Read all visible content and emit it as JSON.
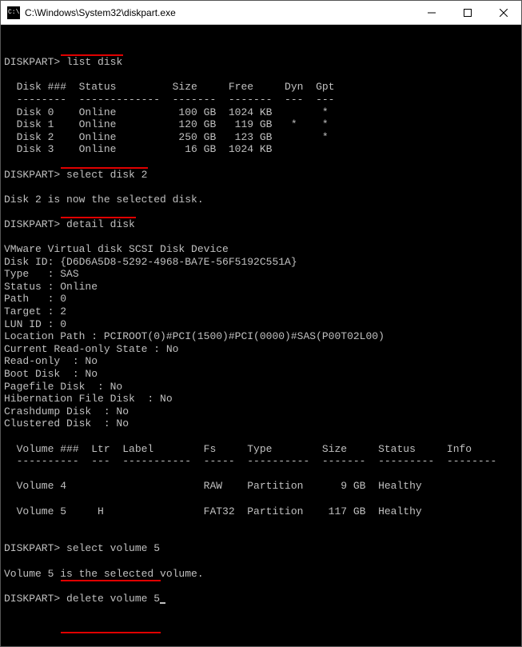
{
  "window": {
    "title": "C:\\Windows\\System32\\diskpart.exe"
  },
  "prompt": "DISKPART>",
  "commands": {
    "list_disk": "list disk",
    "select_disk": "select disk 2",
    "detail_disk": "detail disk",
    "select_volume": "select volume 5",
    "delete_volume": "delete volume 5"
  },
  "disk_table": {
    "header": "  Disk ###  Status         Size     Free     Dyn  Gpt",
    "divider": "  --------  -------------  -------  -------  ---  ---",
    "rows": [
      "  Disk 0    Online          100 GB  1024 KB        *",
      "  Disk 1    Online          120 GB   119 GB   *    *",
      "  Disk 2    Online          250 GB   123 GB        *",
      "  Disk 3    Online           16 GB  1024 KB"
    ]
  },
  "messages": {
    "disk_selected": "Disk 2 is now the selected disk.",
    "volume_selected": "Volume 5 is the selected volume."
  },
  "detail": {
    "device": "VMware Virtual disk SCSI Disk Device",
    "disk_id": "Disk ID: {D6D6A5D8-5292-4968-BA7E-56F5192C551A}",
    "type": "Type   : SAS",
    "status": "Status : Online",
    "path": "Path   : 0",
    "target": "Target : 2",
    "lun": "LUN ID : 0",
    "location": "Location Path : PCIROOT(0)#PCI(1500)#PCI(0000)#SAS(P00T02L00)",
    "readonly_state": "Current Read-only State : No",
    "readonly": "Read-only  : No",
    "boot": "Boot Disk  : No",
    "pagefile": "Pagefile Disk  : No",
    "hibernation": "Hibernation File Disk  : No",
    "crashdump": "Crashdump Disk  : No",
    "clustered": "Clustered Disk  : No"
  },
  "volume_table": {
    "header": "  Volume ###  Ltr  Label        Fs     Type        Size     Status     Info",
    "divider": "  ----------  ---  -----------  -----  ----------  -------  ---------  --------",
    "rows": [
      "  Volume 4                      RAW    Partition      9 GB  Healthy",
      "  Volume 5     H                FAT32  Partition    117 GB  Healthy"
    ]
  }
}
